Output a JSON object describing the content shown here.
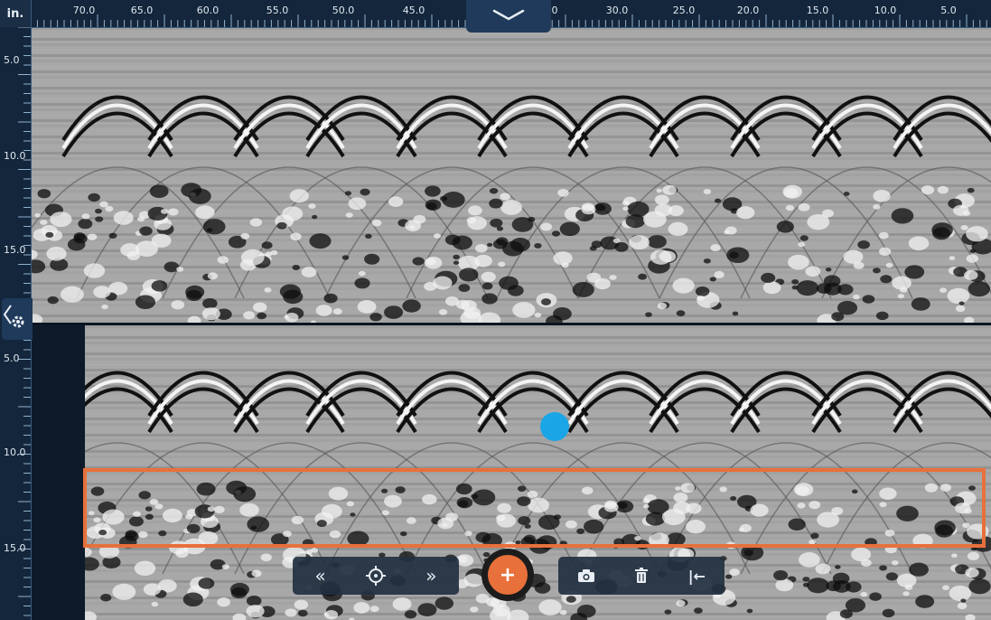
{
  "ruler": {
    "unit": "in.",
    "horizontal_ticks": [
      "70.0",
      "65.0",
      "60.0",
      "55.0",
      "50.0",
      "45.0",
      "0",
      "30.0",
      "25.0",
      "20.0",
      "15.0",
      "10.0",
      "5.0"
    ],
    "top_depth_ticks": [
      "5.0",
      "10.0",
      "15.0"
    ],
    "bottom_depth_ticks": [
      "5.0",
      "10.0",
      "15.0"
    ]
  },
  "controls": {
    "collapse_icon": "chevron-down-icon",
    "settings_icon": "gear-icon",
    "add_label": "+",
    "nav_buttons": [
      {
        "name": "rewind-button",
        "icon": "double-chevron-left-icon",
        "glyph": "«"
      },
      {
        "name": "center-button",
        "icon": "crosshair-icon",
        "glyph": "⊕"
      },
      {
        "name": "forward-button",
        "icon": "double-chevron-right-icon",
        "glyph": "»"
      }
    ],
    "edit_buttons": [
      {
        "name": "camera-button",
        "icon": "camera-icon"
      },
      {
        "name": "delete-button",
        "icon": "trash-icon"
      },
      {
        "name": "jump-start-button",
        "icon": "jump-to-start-icon",
        "glyph": "|←"
      }
    ]
  },
  "colors": {
    "accent": "#e8703a",
    "marker": "#1aa6e6",
    "panel": "#14263b"
  }
}
